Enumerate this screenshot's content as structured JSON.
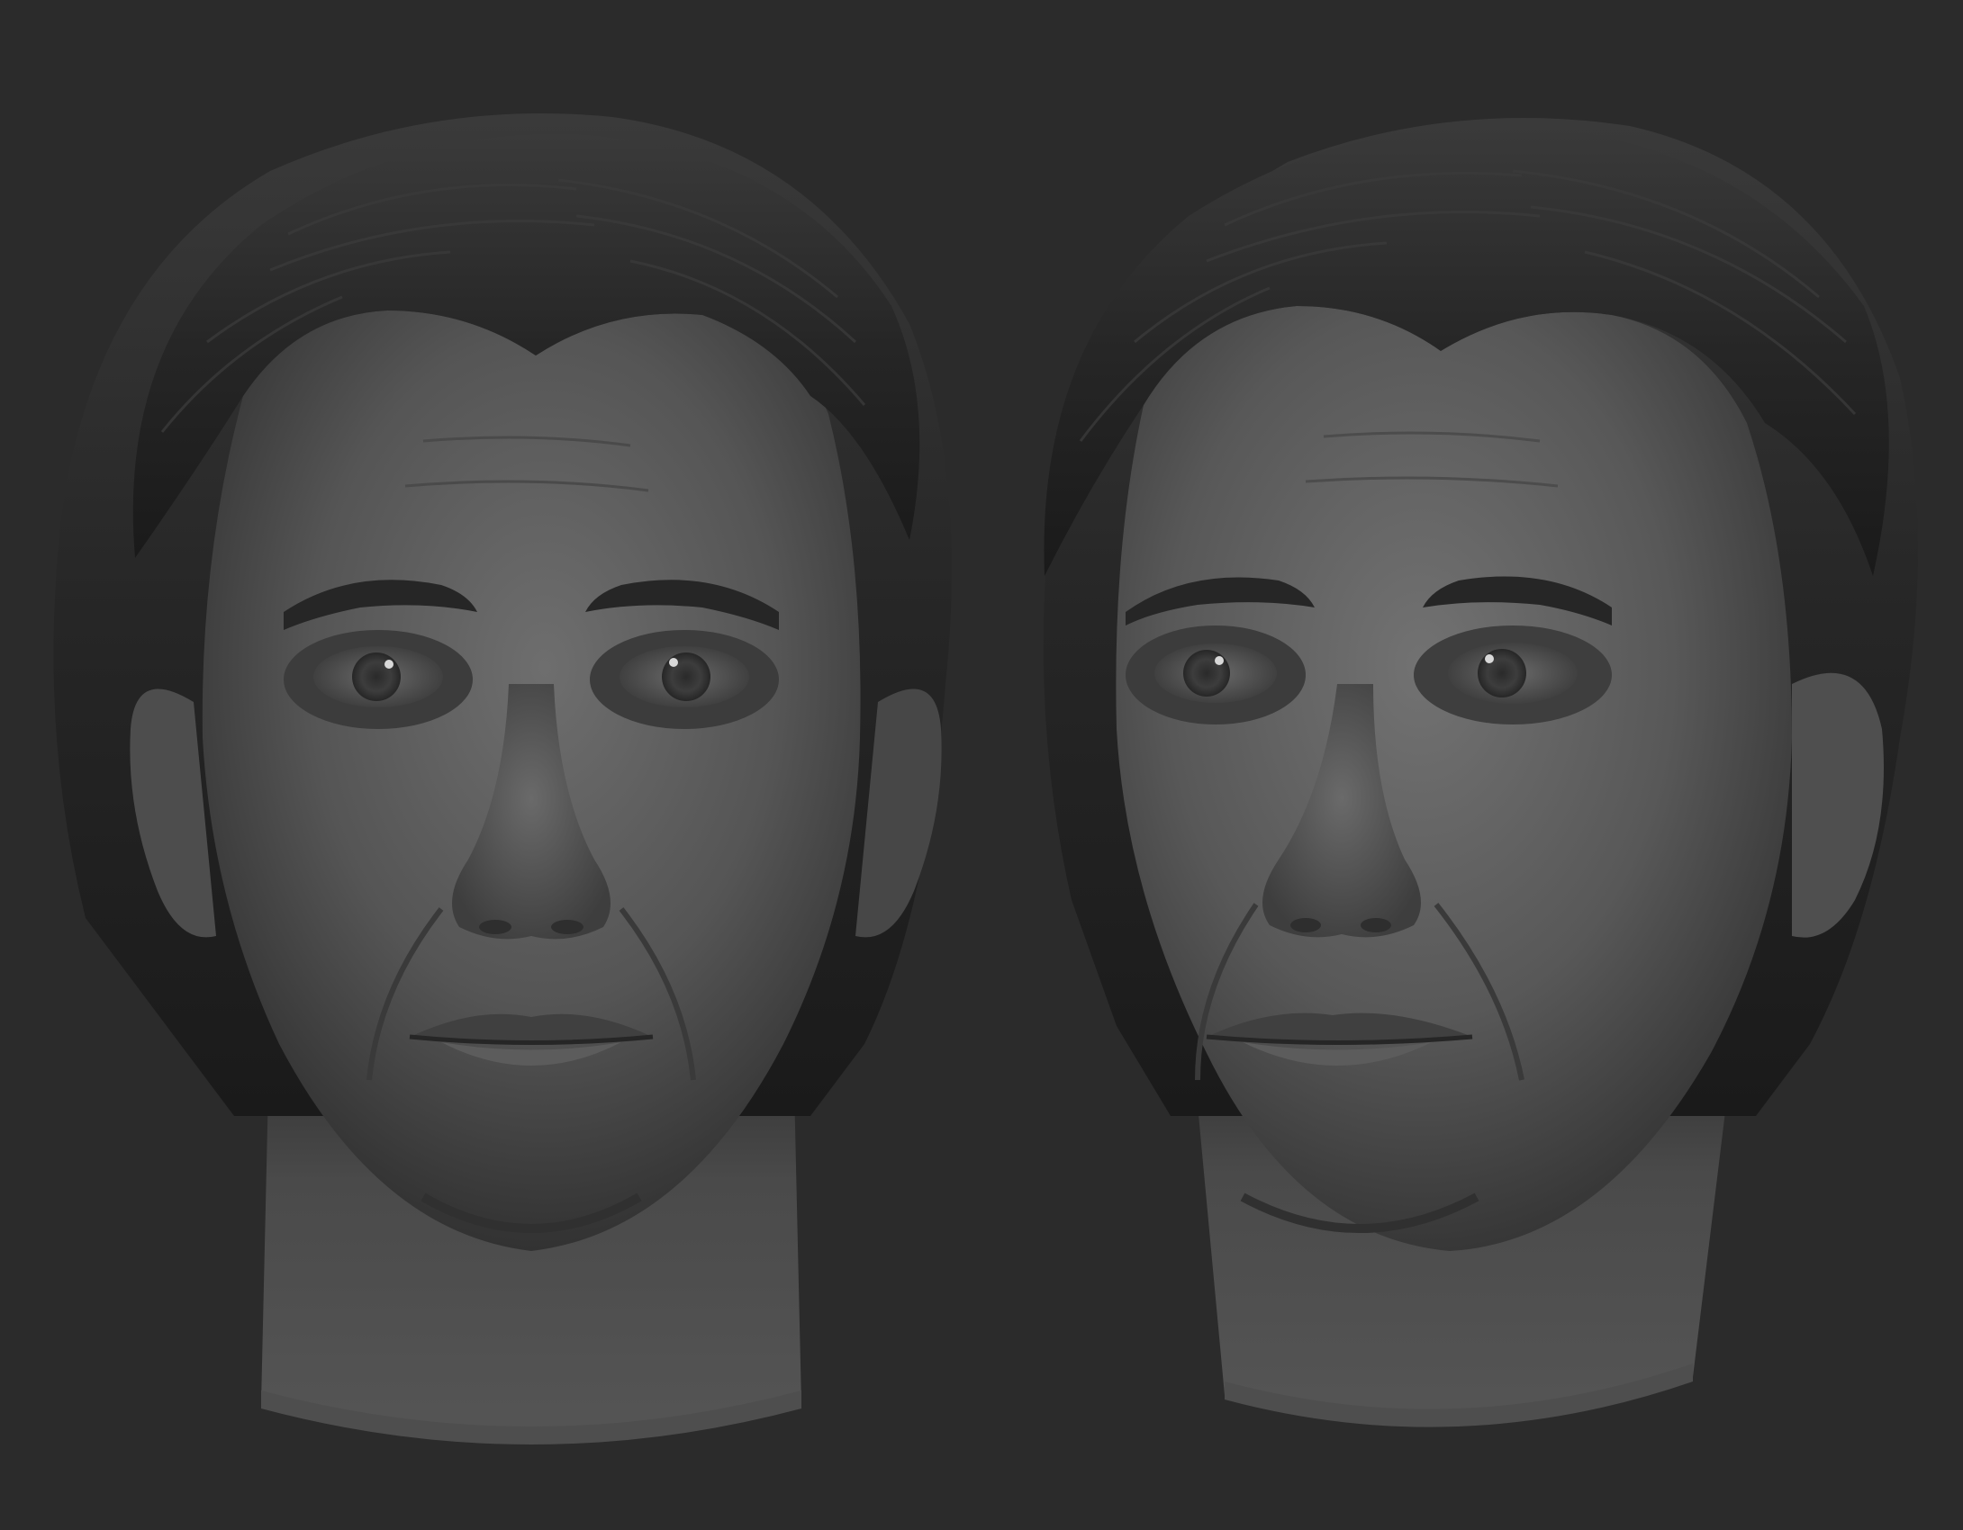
{
  "scene": {
    "background_color": "#2b2b2b",
    "skin_light_color": "#6d6d6d",
    "skin_mid_color": "#565656",
    "skin_dark_color": "#2f2f2f",
    "hair_color": "#1e1e1e",
    "hair_highlight_color": "#3a3a3a"
  },
  "renders": [
    {
      "id": "front-view",
      "view": "front"
    },
    {
      "id": "three-quarter-view",
      "view": "three-quarter"
    }
  ]
}
